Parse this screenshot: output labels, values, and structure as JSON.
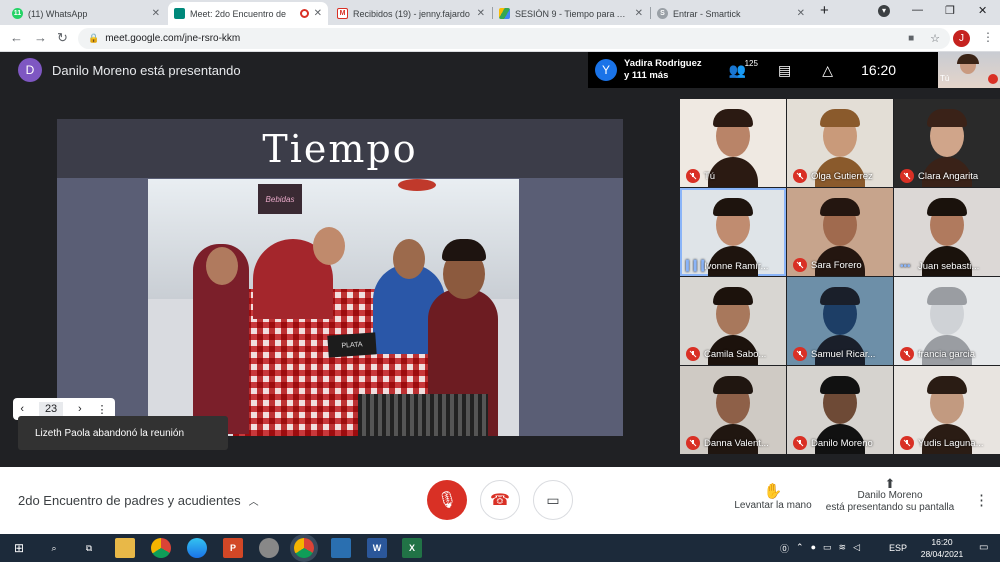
{
  "browser": {
    "tabs": [
      {
        "label": "(11) WhatsApp",
        "icon": "whatsapp-icon"
      },
      {
        "label": "Meet: 2do Encuentro de",
        "icon": "meet-icon"
      },
      {
        "label": "Recibidos (19) - jenny.fajardo",
        "icon": "gmail-icon"
      },
      {
        "label": "SESIÓN 9 - Tiempo para Apre",
        "icon": "drive-icon"
      },
      {
        "label": "Entrar - Smartick",
        "icon": "smartick-icon"
      }
    ],
    "url": "meet.google.com/jne-rsro-kkm",
    "profile_initial": "J"
  },
  "meet": {
    "presenter_initial": "D",
    "presenter_text": "Danilo Moreno está presentando",
    "featured_initial": "Y",
    "featured_text_1": "Yadira Rodriguez",
    "featured_text_2": "y 111 más",
    "participants_count": "125",
    "clock": "16:20",
    "self_label": "Tú",
    "slide_title": "Tiempo",
    "photo_sign": "Bebidas",
    "photo_card": "PLATA",
    "slide_page": "23",
    "toast": "Lizeth Paola abandonó la reunión",
    "meeting_name": "2do Encuentro de padres y acudientes",
    "raise_hand": "Levantar la mano",
    "presenting_line1": "Danilo Moreno",
    "presenting_line2": "está presentando su pantalla"
  },
  "participants": [
    {
      "name": "Tú",
      "muted": true
    },
    {
      "name": "Olga Gutierrez",
      "muted": true
    },
    {
      "name": "Clara Angarita",
      "muted": true
    },
    {
      "name": "Ivonne Ramír...",
      "muted": false,
      "speaking": true
    },
    {
      "name": "Sara Forero",
      "muted": true
    },
    {
      "name": "Juan sebasti...",
      "muted": false
    },
    {
      "name": "Camila Sabo...",
      "muted": true
    },
    {
      "name": "Samuel Ricar...",
      "muted": true
    },
    {
      "name": "francia garcia",
      "muted": true
    },
    {
      "name": "Danna Valent...",
      "muted": true
    },
    {
      "name": "Danilo Moreno",
      "muted": true
    },
    {
      "name": "Yudis Laguna...",
      "muted": true
    }
  ],
  "taskbar": {
    "lang": "ESP",
    "time": "16:20",
    "date": "28/04/2021"
  },
  "colors": {
    "red": "#d93025",
    "meet_bg": "#202124",
    "taskbar": "#1c2a3a"
  }
}
